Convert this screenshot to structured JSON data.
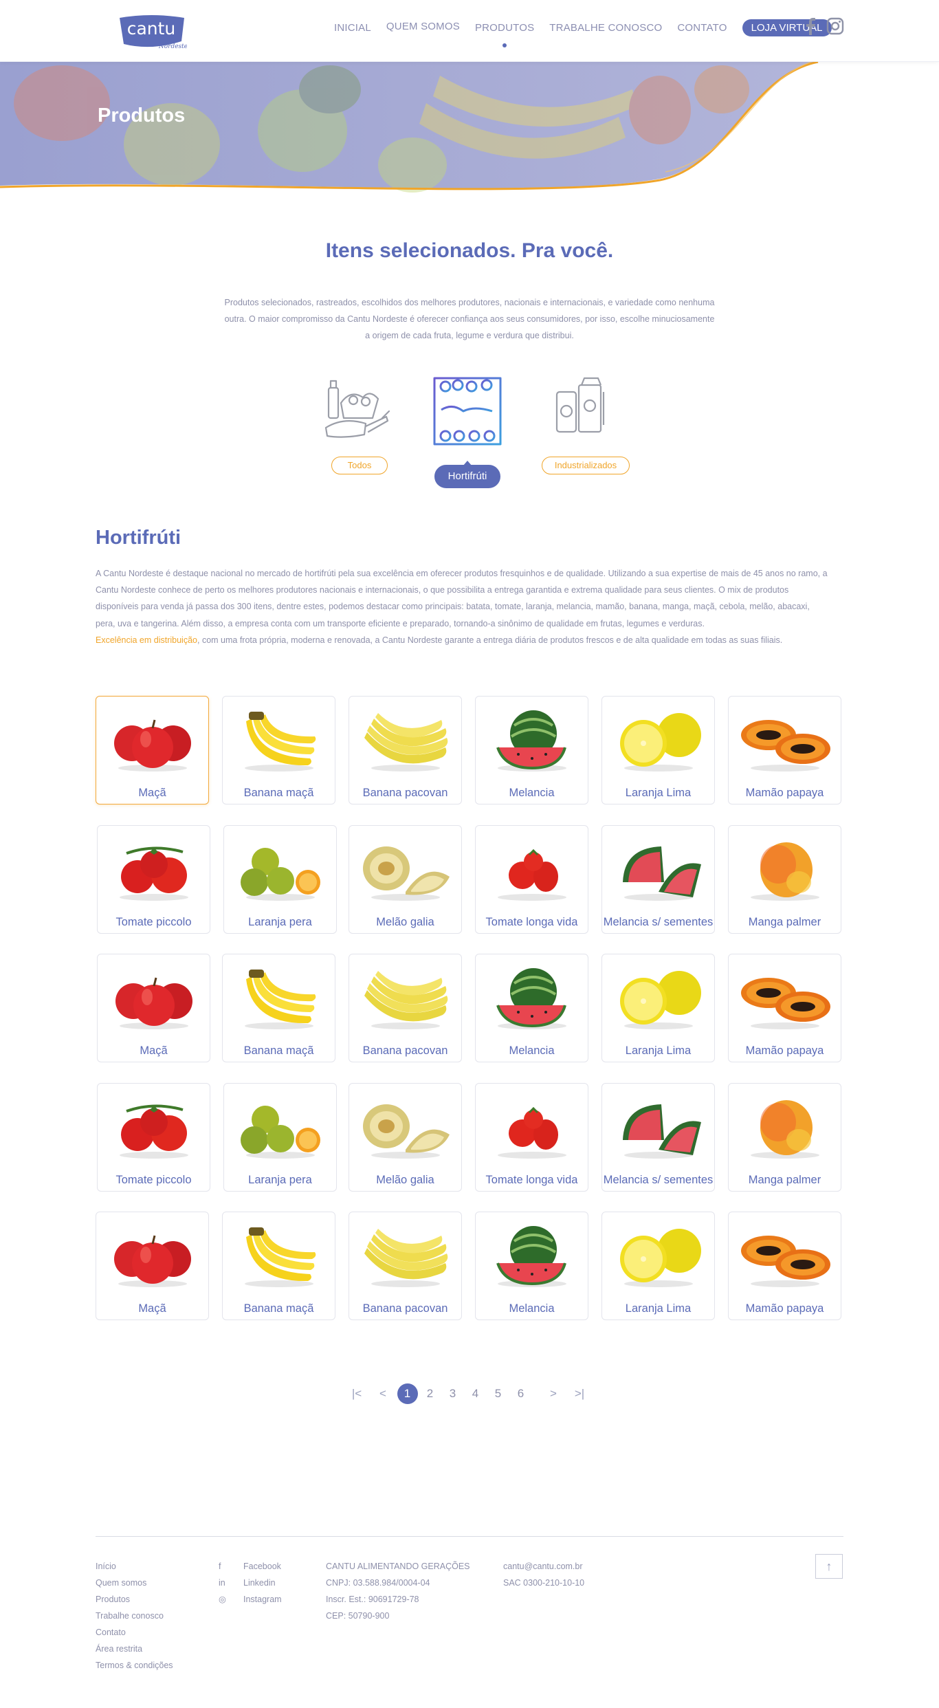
{
  "header": {
    "logo_text": "cantu",
    "logo_subtext": "Nordeste",
    "nav": [
      {
        "label": "INICIAL"
      },
      {
        "label": "QUEM SOMOS"
      },
      {
        "label": "PRODUTOS"
      },
      {
        "label": "TRABALHE CONOSCO"
      },
      {
        "label": "CONTATO"
      }
    ],
    "store_button": "LOJA VIRTUAL",
    "social_icons": [
      "facebook-icon",
      "instagram-icon"
    ]
  },
  "banner": {
    "title": "Produtos"
  },
  "intro": {
    "title": "Itens selecionados. Pra você.",
    "text": "Produtos selecionados, rastreados, escolhidos dos melhores produtores, nacionais e internacionais, e variedade como nenhuma outra. O maior compromisso da Cantu Nordeste é oferecer confiança aos seus consumidores, por isso, escolhe minuciosamente a origem de cada fruta, legume e verdura que distribui."
  },
  "categories": [
    {
      "label": "Todos",
      "icon": "groceries-icon"
    },
    {
      "label": "Hortifrúti",
      "icon": "produce-shelf-icon",
      "active": true
    },
    {
      "label": "Industrializados",
      "icon": "packaged-goods-icon"
    }
  ],
  "section": {
    "title": "Hortifrúti",
    "text_before": "A Cantu Nordeste é destaque nacional no mercado de hortifrúti pela sua excelência em oferecer produtos fresquinhos e de qualidade. Utilizando a sua expertise de mais de 45 anos no ramo, a Cantu Nordeste conhece de perto os melhores produtores nacionais e internacionais, o que possibilita a entrega garantida e extrema qualidade para seus clientes. O mix de produtos disponíveis para venda já passa dos 300 itens, dentre estes, podemos destacar como principais: batata, tomate, laranja, melancia, mamão, banana, manga, maçã, cebola, melão, abacaxi, pera, uva e tangerina. Além disso, a empresa conta com um transporte eficiente e preparado, tornando-a sinônimo de qualidade em frutas, legumes e verduras.",
    "highlight": "Excelência em distribuição",
    "text_after": ", com uma frota própria, moderna e renovada, a Cantu Nordeste garante a entrega diária de produtos frescos e de alta qualidade em todas as suas filiais."
  },
  "products": [
    {
      "label": "Maçã",
      "kind": "apple"
    },
    {
      "label": "Banana maçã",
      "kind": "banana"
    },
    {
      "label": "Banana pacovan",
      "kind": "banana2"
    },
    {
      "label": "Melancia",
      "kind": "watermelon"
    },
    {
      "label": "Laranja Lima",
      "kind": "lemon"
    },
    {
      "label": "Mamão papaya",
      "kind": "papaya"
    },
    {
      "label": "Tomate piccolo",
      "kind": "tomato"
    },
    {
      "label": "Laranja pera",
      "kind": "orange"
    },
    {
      "label": "Melão galia",
      "kind": "melon"
    },
    {
      "label": "Tomate longa vida",
      "kind": "tomato2"
    },
    {
      "label": "Melancia s/ sementes",
      "kind": "watermelon2"
    },
    {
      "label": "Manga palmer",
      "kind": "mango"
    },
    {
      "label": "Maçã",
      "kind": "apple"
    },
    {
      "label": "Banana maçã",
      "kind": "banana"
    },
    {
      "label": "Banana pacovan",
      "kind": "banana2"
    },
    {
      "label": "Melancia",
      "kind": "watermelon"
    },
    {
      "label": "Laranja Lima",
      "kind": "lemon"
    },
    {
      "label": "Mamão papaya",
      "kind": "papaya"
    },
    {
      "label": "Tomate piccolo",
      "kind": "tomato"
    },
    {
      "label": "Laranja pera",
      "kind": "orange"
    },
    {
      "label": "Melão galia",
      "kind": "melon"
    },
    {
      "label": "Tomate longa vida",
      "kind": "tomato2"
    },
    {
      "label": "Melancia s/ sementes",
      "kind": "watermelon2"
    },
    {
      "label": "Manga palmer",
      "kind": "mango"
    },
    {
      "label": "Maçã",
      "kind": "apple"
    },
    {
      "label": "Banana maçã",
      "kind": "banana"
    },
    {
      "label": "Banana pacovan",
      "kind": "banana2"
    },
    {
      "label": "Melancia",
      "kind": "watermelon"
    },
    {
      "label": "Laranja Lima",
      "kind": "lemon"
    },
    {
      "label": "Mamão papaya",
      "kind": "papaya"
    }
  ],
  "pagination": {
    "pages": [
      "1",
      "2",
      "3",
      "4",
      "5",
      "6"
    ],
    "current": "1",
    "first": "|<",
    "prev": "<",
    "next": ">",
    "last": ">|"
  },
  "footer": {
    "links": [
      "Início",
      "Quem somos",
      "Produtos",
      "Trabalhe conosco",
      "Contato",
      "Área restrita",
      "Termos & condições"
    ],
    "social": [
      {
        "label": "Facebook",
        "icon": "f"
      },
      {
        "label": "Linkedin",
        "icon": "in"
      },
      {
        "label": "Instagram",
        "icon": "◎"
      }
    ],
    "company": [
      "CANTU ALIMENTANDO GERAÇÕES",
      "CNPJ: 03.588.984/0004-04",
      "Inscr. Est.: 90691729-78",
      "CEP: 50790-900"
    ],
    "contact": [
      "cantu@cantu.com.br",
      "SAC 0300-210-10-10"
    ],
    "back_to_top": "↑"
  },
  "colors": {
    "primary": "#5b6bb7",
    "accent": "#f0a52a",
    "text": "#8e90aa"
  }
}
